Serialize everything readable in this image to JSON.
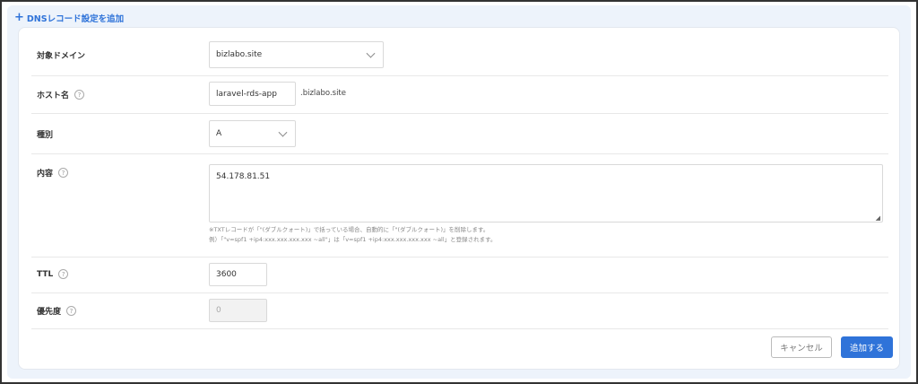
{
  "header": {
    "title": "DNSレコード設定を追加",
    "icon": "plus-icon"
  },
  "fields": {
    "domain": {
      "label": "対象ドメイン",
      "value": "bizlabo.site"
    },
    "host": {
      "label": "ホスト名",
      "value": "laravel-rds-app",
      "suffix": ".bizlabo.site"
    },
    "type": {
      "label": "種別",
      "value": "A"
    },
    "content": {
      "label": "内容",
      "value": "54.178.81.51",
      "note1": "※TXTレコードが「\"(ダブルクォート)」で括っている場合、自動的に「\"(ダブルクォート)」を削除します。",
      "note2": "例）「\"v=spf1 +ip4:xxx.xxx.xxx.xxx ~all\"」は「v=spf1 +ip4:xxx.xxx.xxx.xxx ~all」と登録されます。"
    },
    "ttl": {
      "label": "TTL",
      "value": "3600"
    },
    "priority": {
      "label": "優先度",
      "placeholder": "0"
    }
  },
  "help_icon": "?",
  "buttons": {
    "cancel": "キャンセル",
    "add": "追加する"
  },
  "colors": {
    "accent": "#2f73d9",
    "panel": "#edf3fb"
  }
}
